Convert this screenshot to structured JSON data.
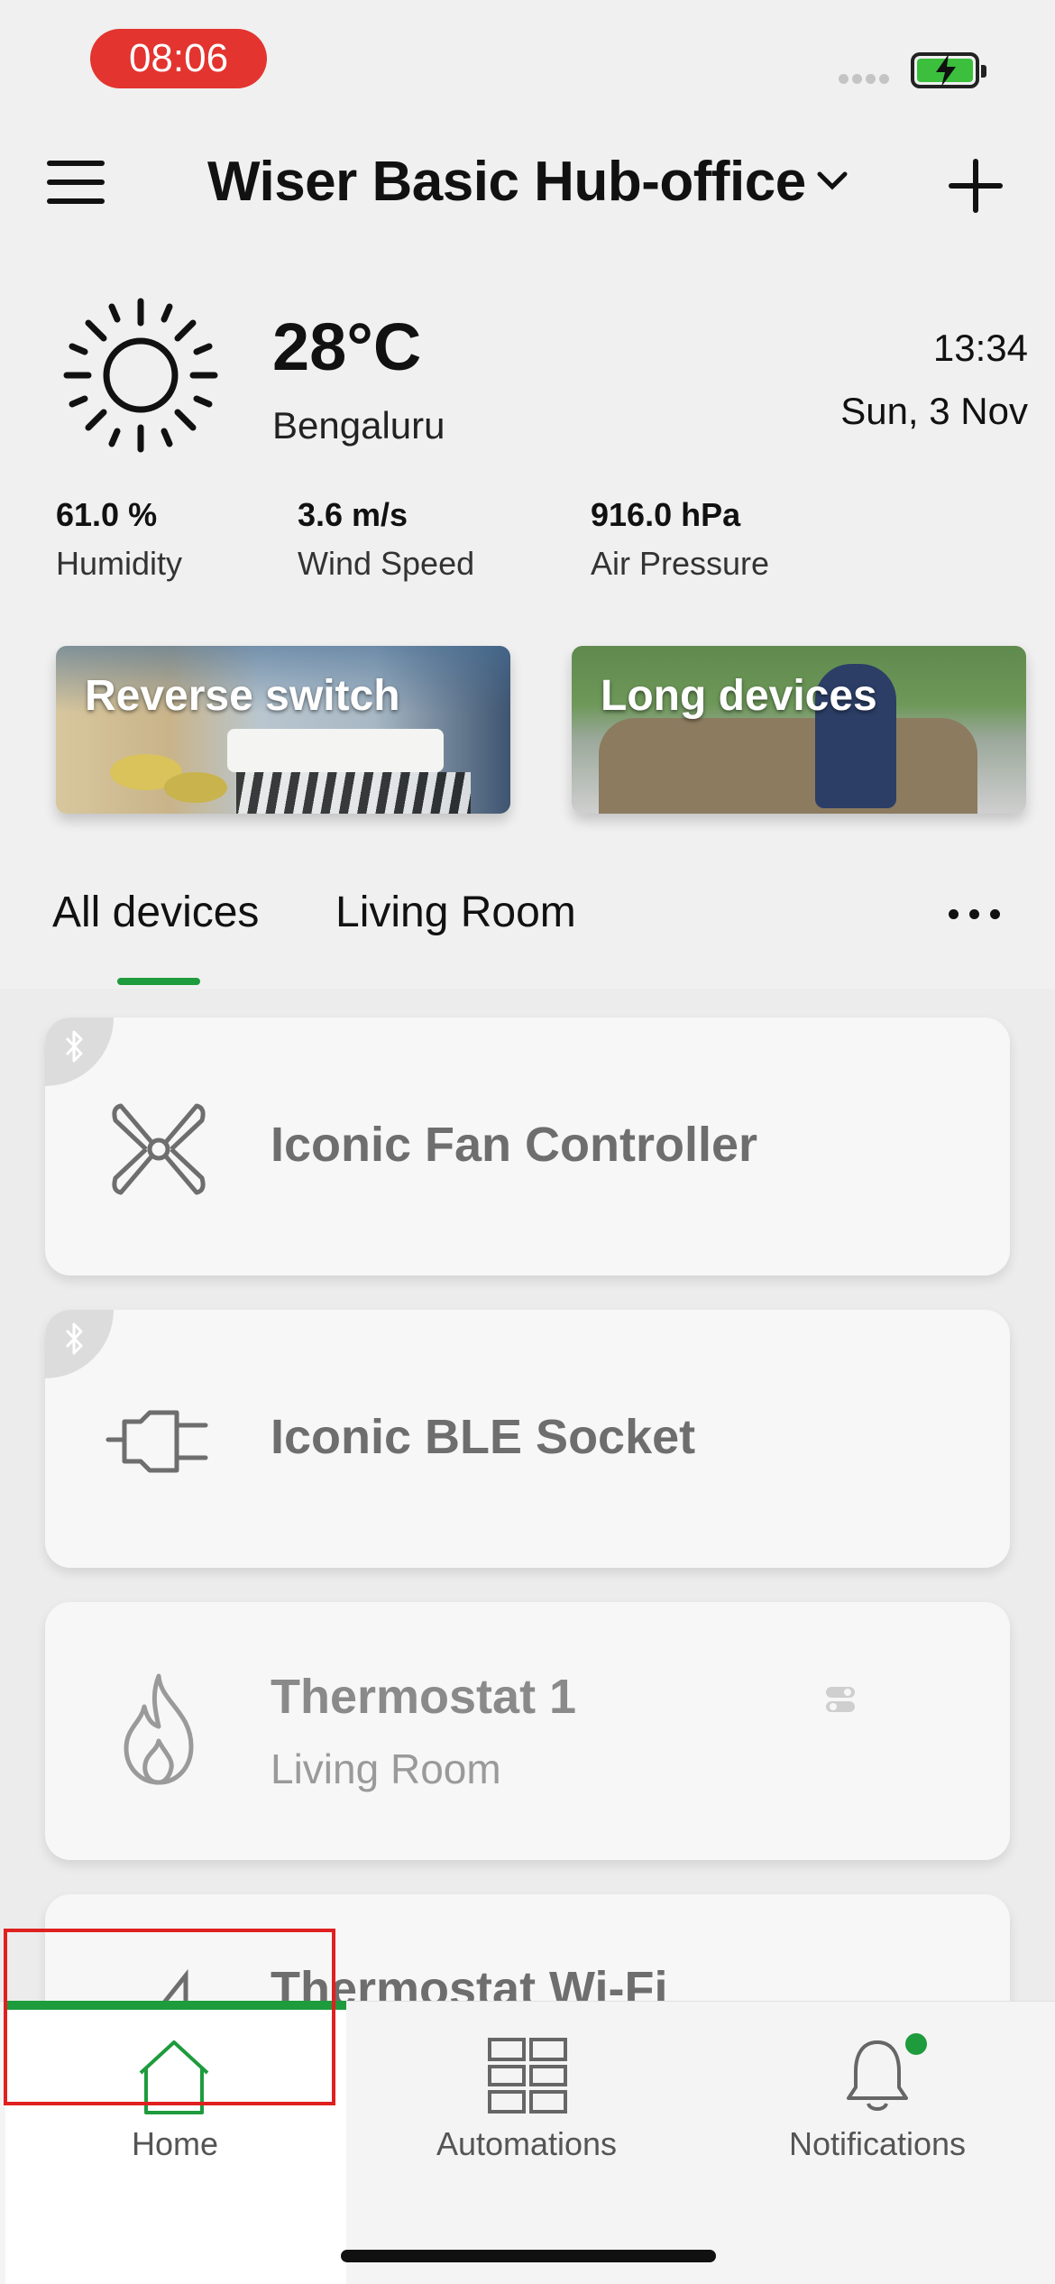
{
  "status_bar": {
    "time": "08:06"
  },
  "header": {
    "hub_name": "Wiser Basic Hub-office"
  },
  "weather": {
    "temperature": "28°C",
    "city": "Bengaluru",
    "time": "13:34",
    "date": "Sun, 3 Nov",
    "stats": [
      {
        "value": "61.0 %",
        "label": "Humidity"
      },
      {
        "value": "3.6 m/s",
        "label": "Wind Speed"
      },
      {
        "value": "916.0 hPa",
        "label": "Air Pressure"
      }
    ]
  },
  "scenes": [
    {
      "label": "Reverse switch"
    },
    {
      "label": "Long devices"
    }
  ],
  "tabs": [
    {
      "label": "All devices",
      "active": true
    },
    {
      "label": "Living Room",
      "active": false
    }
  ],
  "devices": [
    {
      "name": "Iconic Fan Controller",
      "icon": "fan-icon",
      "bluetooth": true
    },
    {
      "name": "Iconic BLE Socket",
      "icon": "plug-icon",
      "bluetooth": true
    },
    {
      "name": "Thermostat 1",
      "room": "Living Room",
      "icon": "flame-icon",
      "bluetooth": false
    },
    {
      "name": "Thermostat Wi-Fi",
      "icon": "thermostat-icon",
      "bluetooth": false
    }
  ],
  "bottom_nav": [
    {
      "label": "Home",
      "icon": "home-icon",
      "active": true
    },
    {
      "label": "Automations",
      "icon": "grid-icon",
      "active": false
    },
    {
      "label": "Notifications",
      "icon": "bell-icon",
      "active": false
    }
  ],
  "colors": {
    "accent": "#1e9b3c",
    "time_pill": "#e3342f",
    "highlight_box": "#e02020"
  }
}
